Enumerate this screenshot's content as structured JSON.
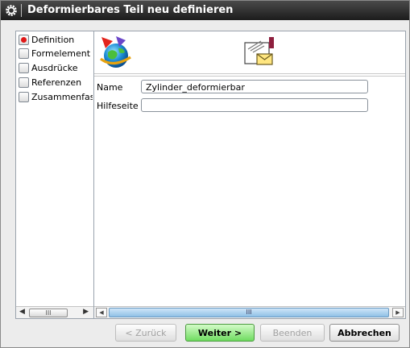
{
  "window": {
    "title": "Deformierbares Teil neu definieren",
    "icon": "gear-icon"
  },
  "steps": [
    {
      "label": "Definition",
      "state": "active"
    },
    {
      "label": "Formelement",
      "state": "inactive"
    },
    {
      "label": "Ausdrücke",
      "state": "inactive"
    },
    {
      "label": "Referenzen",
      "state": "inactive"
    },
    {
      "label": "Zusammenfas",
      "state": "inactive"
    }
  ],
  "panel": {
    "icons": [
      "globe-arrow-icon",
      "document-envelope-icon"
    ],
    "fields": [
      {
        "label": "Name",
        "value": "Zylinder_deformierbar"
      },
      {
        "label": "Hilfeseite",
        "value": ""
      }
    ]
  },
  "scroll": {
    "left_thumb": "III",
    "right_thumb": "III"
  },
  "buttons": {
    "back": "< Zurück",
    "next": "Weiter >",
    "finish": "Beenden",
    "cancel": "Abbrechen"
  }
}
